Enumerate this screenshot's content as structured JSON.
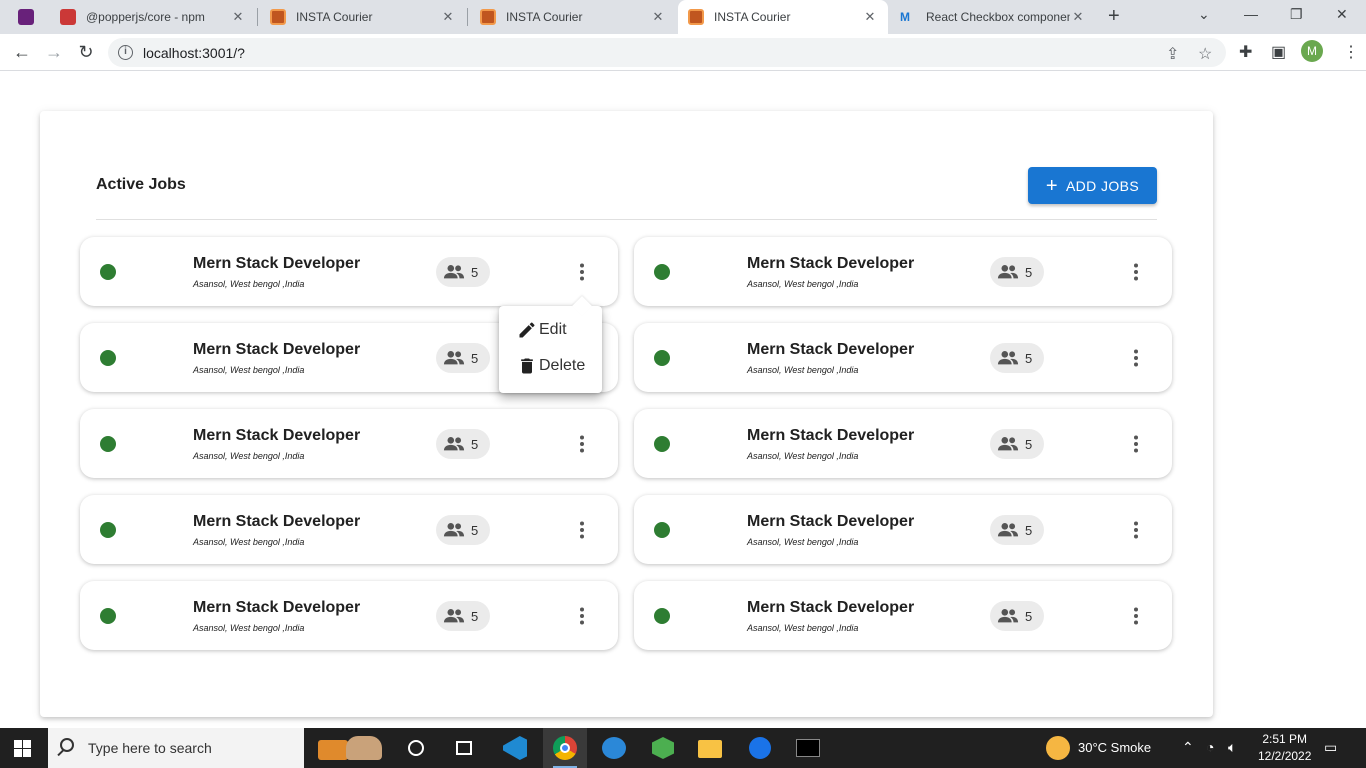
{
  "browser": {
    "tabs": [
      {
        "label": "",
        "favicon": "visual-studio-icon"
      },
      {
        "label": "@popperjs/core - npm",
        "favicon": "npm-icon"
      },
      {
        "label": "INSTA Courier",
        "favicon": "insta-courier-icon"
      },
      {
        "label": "INSTA Courier",
        "favicon": "insta-courier-icon"
      },
      {
        "label": "INSTA Courier",
        "favicon": "insta-courier-icon",
        "active": true
      },
      {
        "label": "React Checkbox componen",
        "favicon": "mui-icon"
      }
    ],
    "url": "localhost:3001/?",
    "profile_initial": "M"
  },
  "page": {
    "title": "Active Jobs",
    "add_button": "ADD JOBS",
    "accent_color": "#1976d2",
    "status_color": "#2e7d32",
    "jobs": [
      {
        "title": "Mern Stack Developer",
        "location": "Asansol, West bengol ,India",
        "applicants": "5"
      },
      {
        "title": "Mern Stack Developer",
        "location": "Asansol, West bengol ,India",
        "applicants": "5"
      },
      {
        "title": "Mern Stack Developer",
        "location": "Asansol, West bengol ,India",
        "applicants": "5"
      },
      {
        "title": "Mern Stack Developer",
        "location": "Asansol, West bengol ,India",
        "applicants": "5"
      },
      {
        "title": "Mern Stack Developer",
        "location": "Asansol, West bengol ,India",
        "applicants": "5"
      },
      {
        "title": "Mern Stack Developer",
        "location": "Asansol, West bengol ,India",
        "applicants": "5"
      },
      {
        "title": "Mern Stack Developer",
        "location": "Asansol, West bengol ,India",
        "applicants": "5"
      },
      {
        "title": "Mern Stack Developer",
        "location": "Asansol, West bengol ,India",
        "applicants": "5"
      },
      {
        "title": "Mern Stack Developer",
        "location": "Asansol, West bengol ,India",
        "applicants": "5"
      },
      {
        "title": "Mern Stack Developer",
        "location": "Asansol, West bengol ,India",
        "applicants": "5"
      }
    ],
    "menu": {
      "edit": "Edit",
      "delete": "Delete"
    }
  },
  "taskbar": {
    "search_placeholder": "Type here to search",
    "weather": "30°C  Smoke",
    "time": "2:51 PM",
    "date": "12/2/2022"
  }
}
